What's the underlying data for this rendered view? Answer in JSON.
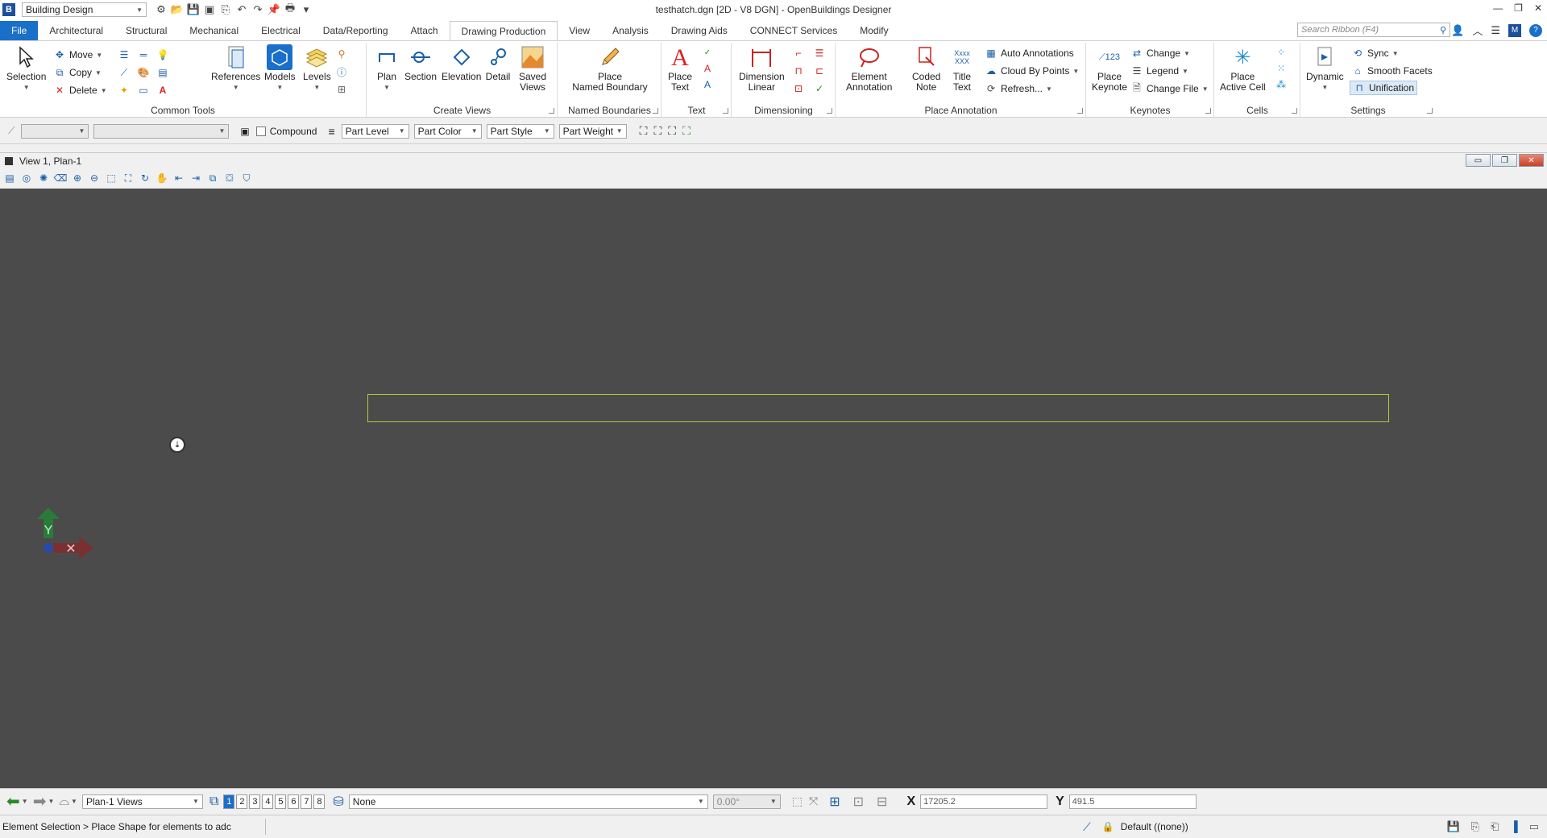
{
  "titlebar": {
    "workflow": "Building Design",
    "window_title": "testhatch.dgn [2D - V8 DGN] - OpenBuildings Designer"
  },
  "tabs": {
    "file": "File",
    "items": [
      "Architectural",
      "Structural",
      "Mechanical",
      "Electrical",
      "Data/Reporting",
      "Attach",
      "Drawing Production",
      "View",
      "Analysis",
      "Drawing Aids",
      "CONNECT Services",
      "Modify"
    ],
    "active": "Drawing Production",
    "search_placeholder": "Search Ribbon (F4)"
  },
  "ribbon": {
    "common_tools": {
      "label": "Common Tools",
      "selection": "Selection",
      "move": "Move",
      "copy": "Copy",
      "delete": "Delete",
      "references": "References",
      "models": "Models",
      "levels": "Levels"
    },
    "create_views": {
      "label": "Create Views",
      "plan": "Plan",
      "section": "Section",
      "elevation": "Elevation",
      "detail": "Detail",
      "saved_views_1": "Saved",
      "saved_views_2": "Views"
    },
    "named_boundaries": {
      "label": "Named Boundaries",
      "place_1": "Place",
      "place_2": "Named Boundary"
    },
    "text": {
      "label": "Text",
      "place_1": "Place",
      "place_2": "Text"
    },
    "dimensioning": {
      "label": "Dimensioning",
      "dim_1": "Dimension",
      "dim_2": "Linear"
    },
    "place_annotation": {
      "label": "Place Annotation",
      "element_1": "Element",
      "element_2": "Annotation",
      "coded_1": "Coded",
      "coded_2": "Note",
      "title_1": "Title",
      "title_2": "Text",
      "auto": "Auto Annotations",
      "cloud": "Cloud By Points",
      "refresh": "Refresh..."
    },
    "keynotes": {
      "label": "Keynotes",
      "place_1": "Place",
      "place_2": "Keynote",
      "change": "Change",
      "legend": "Legend",
      "change_file": "Change File"
    },
    "cells": {
      "label": "Cells",
      "place_1": "Place",
      "place_2": "Active Cell"
    },
    "settings": {
      "label": "Settings",
      "dynamic": "Dynamic",
      "sync": "Sync",
      "smooth": "Smooth Facets",
      "unification": "Unification"
    }
  },
  "attrbar": {
    "compound": "Compound",
    "part_level": "Part Level",
    "part_color": "Part Color",
    "part_style": "Part Style",
    "part_weight": "Part Weight"
  },
  "view": {
    "title": "View 1, Plan-1",
    "axis_y": "Y",
    "axis_x": "✕"
  },
  "statusbar": {
    "views_combo": "Plan-1 Views",
    "view_numbers": [
      "1",
      "2",
      "3",
      "4",
      "5",
      "6",
      "7",
      "8"
    ],
    "level_combo": "None",
    "angle": "0.00°",
    "x_label": "X",
    "x_value": "17205.2",
    "y_label": "Y",
    "y_value": "491.5",
    "prompt": "Element Selection > Place Shape for elements to adc",
    "model": "Default ((none))"
  }
}
